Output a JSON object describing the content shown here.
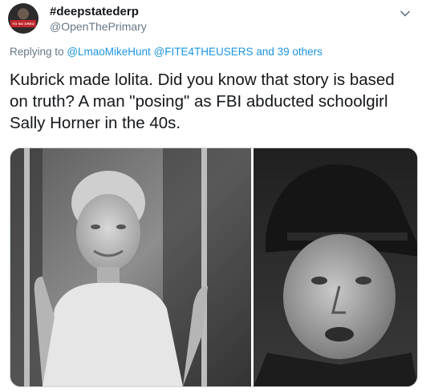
{
  "author": {
    "display_name": "#deepstatederp",
    "handle": "@OpenThePrimary",
    "avatar_badge_text": "YO NO CREO EN FRONTERAS"
  },
  "reply": {
    "prefix": "Replying to",
    "mention1": "@LmaoMikeHunt",
    "mention2": "@FITE4THEUSERS",
    "suffix": "and 39 others"
  },
  "tweet": {
    "text": "Kubrick made lolita. Did you know that story is based on truth? A man \"posing\" as FBI abducted schoolgirl Sally Horner in the 40s."
  },
  "icons": {
    "menu_caret": "chevron-down-icon"
  },
  "colors": {
    "link": "#1b95e0",
    "secondary_text": "#657786",
    "primary_text": "#14171a"
  }
}
